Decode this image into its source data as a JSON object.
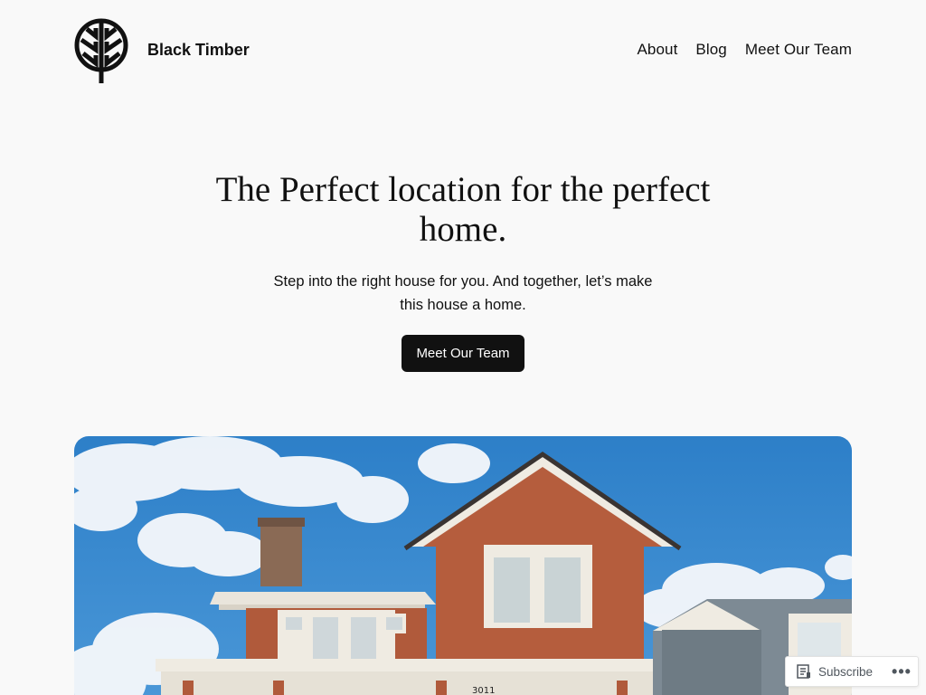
{
  "site": {
    "title": "Black Timber",
    "logo_icon": "tree-leaf-logo-icon"
  },
  "nav": {
    "items": [
      {
        "label": "About"
      },
      {
        "label": "Blog"
      },
      {
        "label": "Meet Our Team"
      }
    ]
  },
  "hero": {
    "heading": "The Perfect location for the perfect home.",
    "subtext": "Step into the right house for you. And together, let’s make this house a home.",
    "cta_label": "Meet Our Team"
  },
  "featured_image": {
    "house_number": "3011"
  },
  "subscribe_bar": {
    "subscribe_label": "Subscribe",
    "subscribe_icon": "reader-icon",
    "more_icon": "ellipsis-icon",
    "more_label": "•••"
  }
}
